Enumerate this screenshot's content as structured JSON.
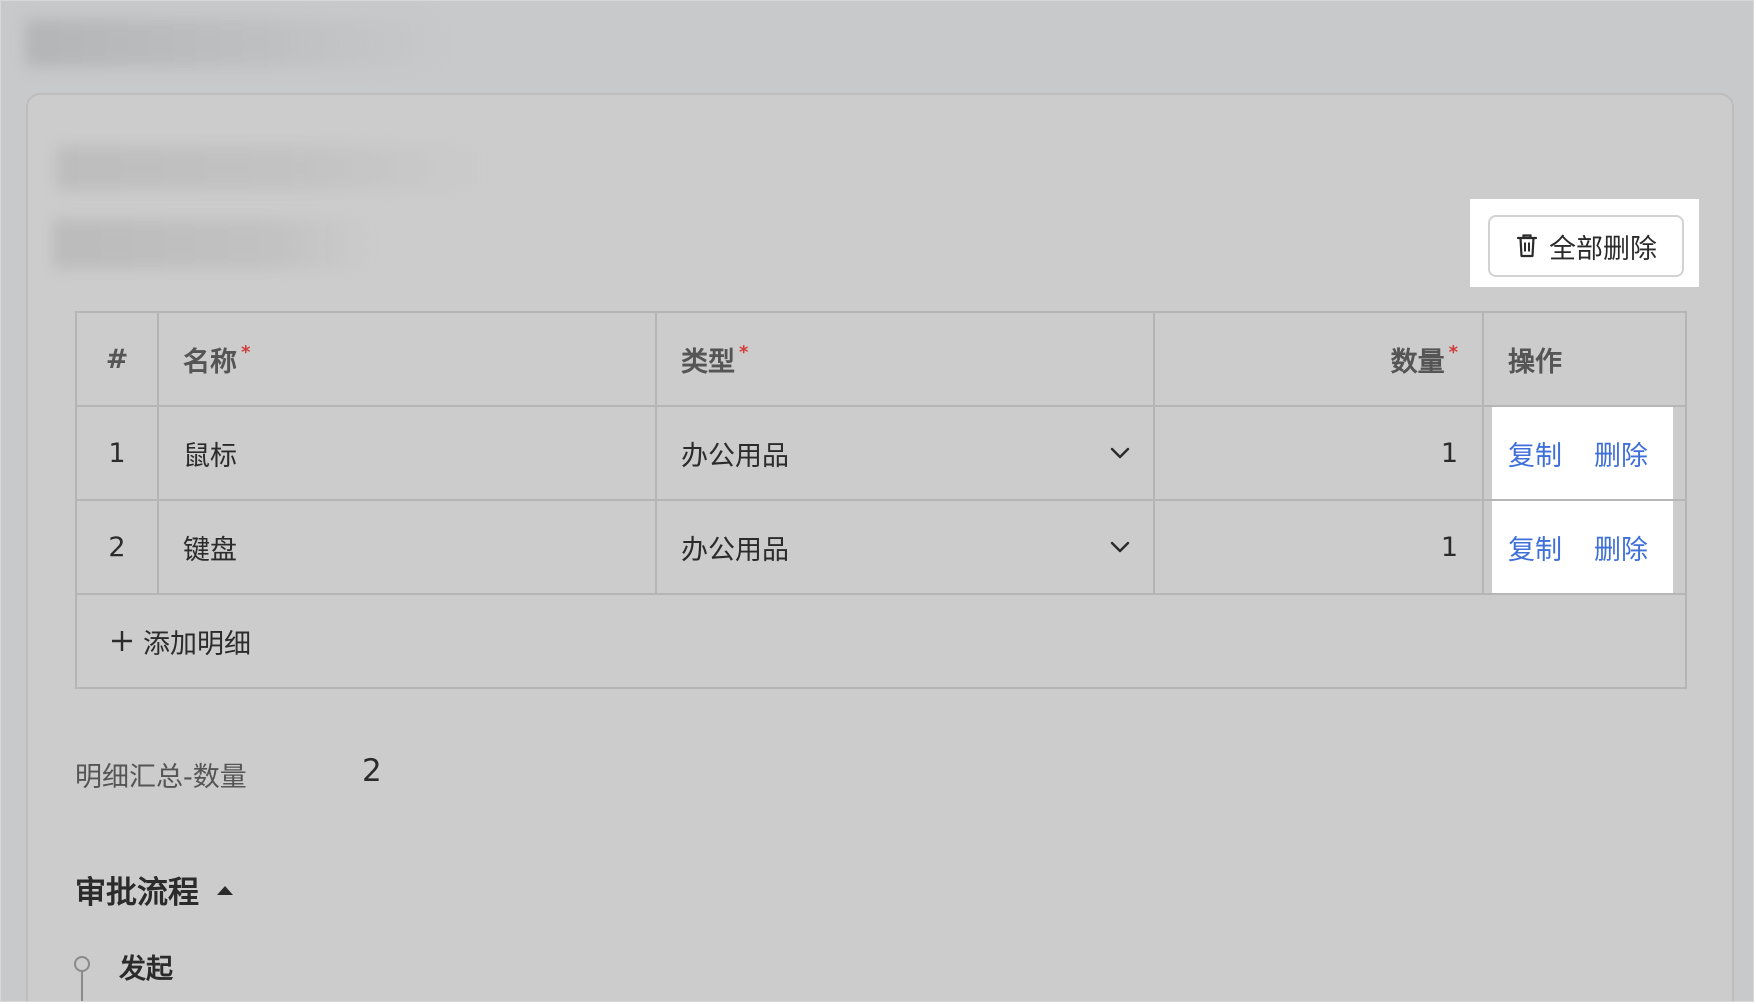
{
  "toolbar": {
    "delete_all_label": "全部删除",
    "delete_icon": "trash-icon"
  },
  "table": {
    "headers": [
      {
        "label": "#",
        "required": false
      },
      {
        "label": "名称",
        "required": true
      },
      {
        "label": "类型",
        "required": true
      },
      {
        "label": "数量",
        "required": true
      },
      {
        "label": "操作",
        "required": false
      }
    ],
    "required_mark": "*",
    "rows": [
      {
        "index": "1",
        "name": "鼠标",
        "type": "办公用品",
        "quantity": "1",
        "copy_label": "复制",
        "delete_label": "删除"
      },
      {
        "index": "2",
        "name": "键盘",
        "type": "办公用品",
        "quantity": "1",
        "copy_label": "复制",
        "delete_label": "删除"
      }
    ],
    "add_label": "添加明细"
  },
  "summary": {
    "label": "明细汇总-数量",
    "value": "2"
  },
  "approval": {
    "title": "审批流程",
    "steps": [
      {
        "label": "发起"
      }
    ]
  },
  "colors": {
    "link": "#3f6fd8",
    "required": "#d23b3b",
    "overlay": "#c8c9cb"
  }
}
